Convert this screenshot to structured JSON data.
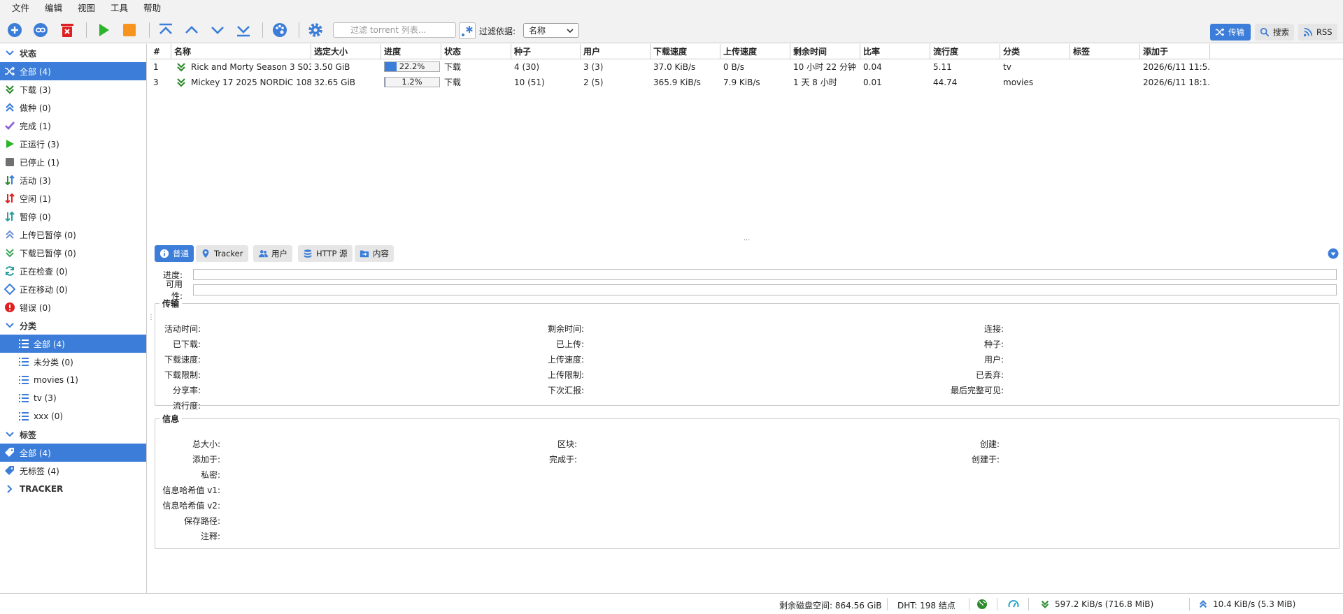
{
  "menu": [
    "文件",
    "编辑",
    "视图",
    "工具",
    "帮助"
  ],
  "toolbar": {
    "filter_placeholder": "过滤 torrent 列表...",
    "filter_by_label": "过滤依据:",
    "filter_by_value": "名称",
    "view_transfers": "传输",
    "view_search": "搜索",
    "view_rss": "RSS"
  },
  "colors": {
    "accent": "#3b7dd8",
    "start": "#2ab52a",
    "stop": "#f7941d",
    "delete": "#e02020",
    "download": "#2e8b2e",
    "upload": "#3b7dd8"
  },
  "sidebar": {
    "status_header": "状态",
    "status": [
      {
        "label": "全部 (4)",
        "icon": "shuffle-icon"
      },
      {
        "label": "下载 (3)",
        "icon": "download-chevron-icon"
      },
      {
        "label": "做种 (0)",
        "icon": "upload-chevron-icon"
      },
      {
        "label": "完成 (1)",
        "icon": "checkmark-icon"
      },
      {
        "label": "正运行 (3)",
        "icon": "play-icon"
      },
      {
        "label": "已停止 (1)",
        "icon": "stop-icon"
      },
      {
        "label": "活动 (3)",
        "icon": "active-arrows-icon"
      },
      {
        "label": "空闲 (1)",
        "icon": "idle-arrows-icon"
      },
      {
        "label": "暂停 (0)",
        "icon": "paused-arrows-icon"
      },
      {
        "label": "上传已暂停 (0)",
        "icon": "upload-paused-icon"
      },
      {
        "label": "下载已暂停 (0)",
        "icon": "download-paused-icon"
      },
      {
        "label": "正在检查 (0)",
        "icon": "checking-icon"
      },
      {
        "label": "正在移动 (0)",
        "icon": "moving-icon"
      },
      {
        "label": "错误 (0)",
        "icon": "error-icon"
      }
    ],
    "category_header": "分类",
    "categories": [
      "全部 (4)",
      "未分类 (0)",
      "movies (1)",
      "tv (3)",
      "xxx (0)"
    ],
    "tag_header": "标签",
    "tags": [
      "全部 (4)",
      "无标签 (4)"
    ],
    "tracker_header": "TRACKER"
  },
  "table": {
    "columns": [
      "#",
      "名称",
      "选定大小",
      "进度",
      "状态",
      "种子",
      "用户",
      "下载速度",
      "上传速度",
      "剩余时间",
      "比率",
      "流行度",
      "分类",
      "标签",
      "添加于"
    ],
    "rows": [
      {
        "num": "1",
        "name": "Rick and Morty Season 3 S03...",
        "size": "3.50 GiB",
        "progress": 22.2,
        "progress_text": "22.2%",
        "status": "下载",
        "seeds": "4 (30)",
        "peers": "3 (3)",
        "dl": "37.0 KiB/s",
        "ul": "0 B/s",
        "eta": "10 小时 22 分钟",
        "ratio": "0.04",
        "popularity": "5.11",
        "category": "tv",
        "tags": "",
        "added": "2026/6/11 11:5..."
      },
      {
        "num": "3",
        "name": "Mickey 17 2025 NORDiC 108...",
        "size": "32.65 GiB",
        "progress": 1.2,
        "progress_text": "1.2%",
        "status": "下载",
        "seeds": "10 (51)",
        "peers": "2 (5)",
        "dl": "365.9 KiB/s",
        "ul": "7.9 KiB/s",
        "eta": "1 天 8 小时",
        "ratio": "0.01",
        "popularity": "44.74",
        "category": "movies",
        "tags": "",
        "added": "2026/6/11 18:1..."
      }
    ]
  },
  "tabs": [
    "普通",
    "Tracker",
    "用户",
    "HTTP 源",
    "内容"
  ],
  "general": {
    "progress_label": "进度:",
    "availability_label": "可用性:",
    "transfer_title": "传输",
    "transfer_c1": [
      "活动时间:",
      "已下载:",
      "下载速度:",
      "下载限制:",
      "分享率:",
      "流行度:"
    ],
    "transfer_c2": [
      "剩余时间:",
      "已上传:",
      "上传速度:",
      "上传限制:",
      "下次汇报:"
    ],
    "transfer_c3": [
      "连接:",
      "种子:",
      "用户:",
      "已丢弃:",
      "最后完整可见:"
    ],
    "info_title": "信息",
    "info_c1": [
      "总大小:",
      "添加于:",
      "私密:",
      "信息哈希值 v1:",
      "信息哈希值 v2:",
      "保存路径:",
      "注释:"
    ],
    "info_c2": [
      "区块:",
      "完成于:"
    ],
    "info_c3": [
      "创建:",
      "创建于:"
    ]
  },
  "statusbar": {
    "free_space": "剩余磁盘空间: 864.56 GiB",
    "dht": "DHT: 198 结点",
    "dl_speed": "597.2 KiB/s (716.8 MiB)",
    "ul_speed": "10.4 KiB/s (5.3 MiB)"
  }
}
